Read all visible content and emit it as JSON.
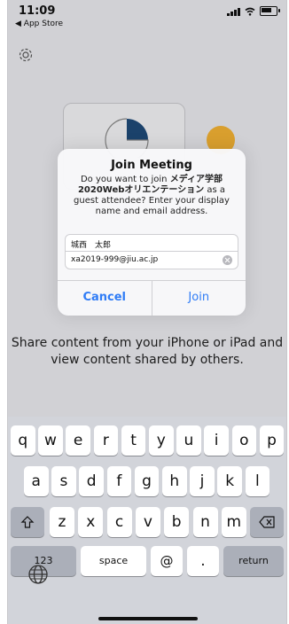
{
  "status": {
    "time": "11:09",
    "back": "◀ App Store"
  },
  "dialog": {
    "title": "Join Meeting",
    "msg_prefix": "Do you want to join",
    "meeting_name": "メディア学部2020Webオリエンテーション",
    "msg_suffix": "as a guest attendee? Enter your display name and email address.",
    "name_value": "城西　太郎",
    "email_value": "xa2019-999@jiu.ac.jp",
    "cancel_label": "Cancel",
    "join_label": "Join"
  },
  "info_text": "Share content from your iPhone or iPad and view content shared by others.",
  "keyboard": {
    "row1": [
      "q",
      "w",
      "e",
      "r",
      "t",
      "y",
      "u",
      "i",
      "o",
      "p"
    ],
    "row2": [
      "a",
      "s",
      "d",
      "f",
      "g",
      "h",
      "j",
      "k",
      "l"
    ],
    "row3": [
      "z",
      "x",
      "c",
      "v",
      "b",
      "n",
      "m"
    ],
    "numbers_label": "123",
    "space_label": "space",
    "at_label": "@",
    "dot_label": ".",
    "return_label": "return"
  },
  "colors": {
    "accent": "#2f7cf6",
    "folder": "#f2b134",
    "pie": "#1f4a78"
  },
  "icons": [
    "gear-icon",
    "shift-icon",
    "backspace-icon",
    "globe-icon",
    "clear-icon"
  ]
}
